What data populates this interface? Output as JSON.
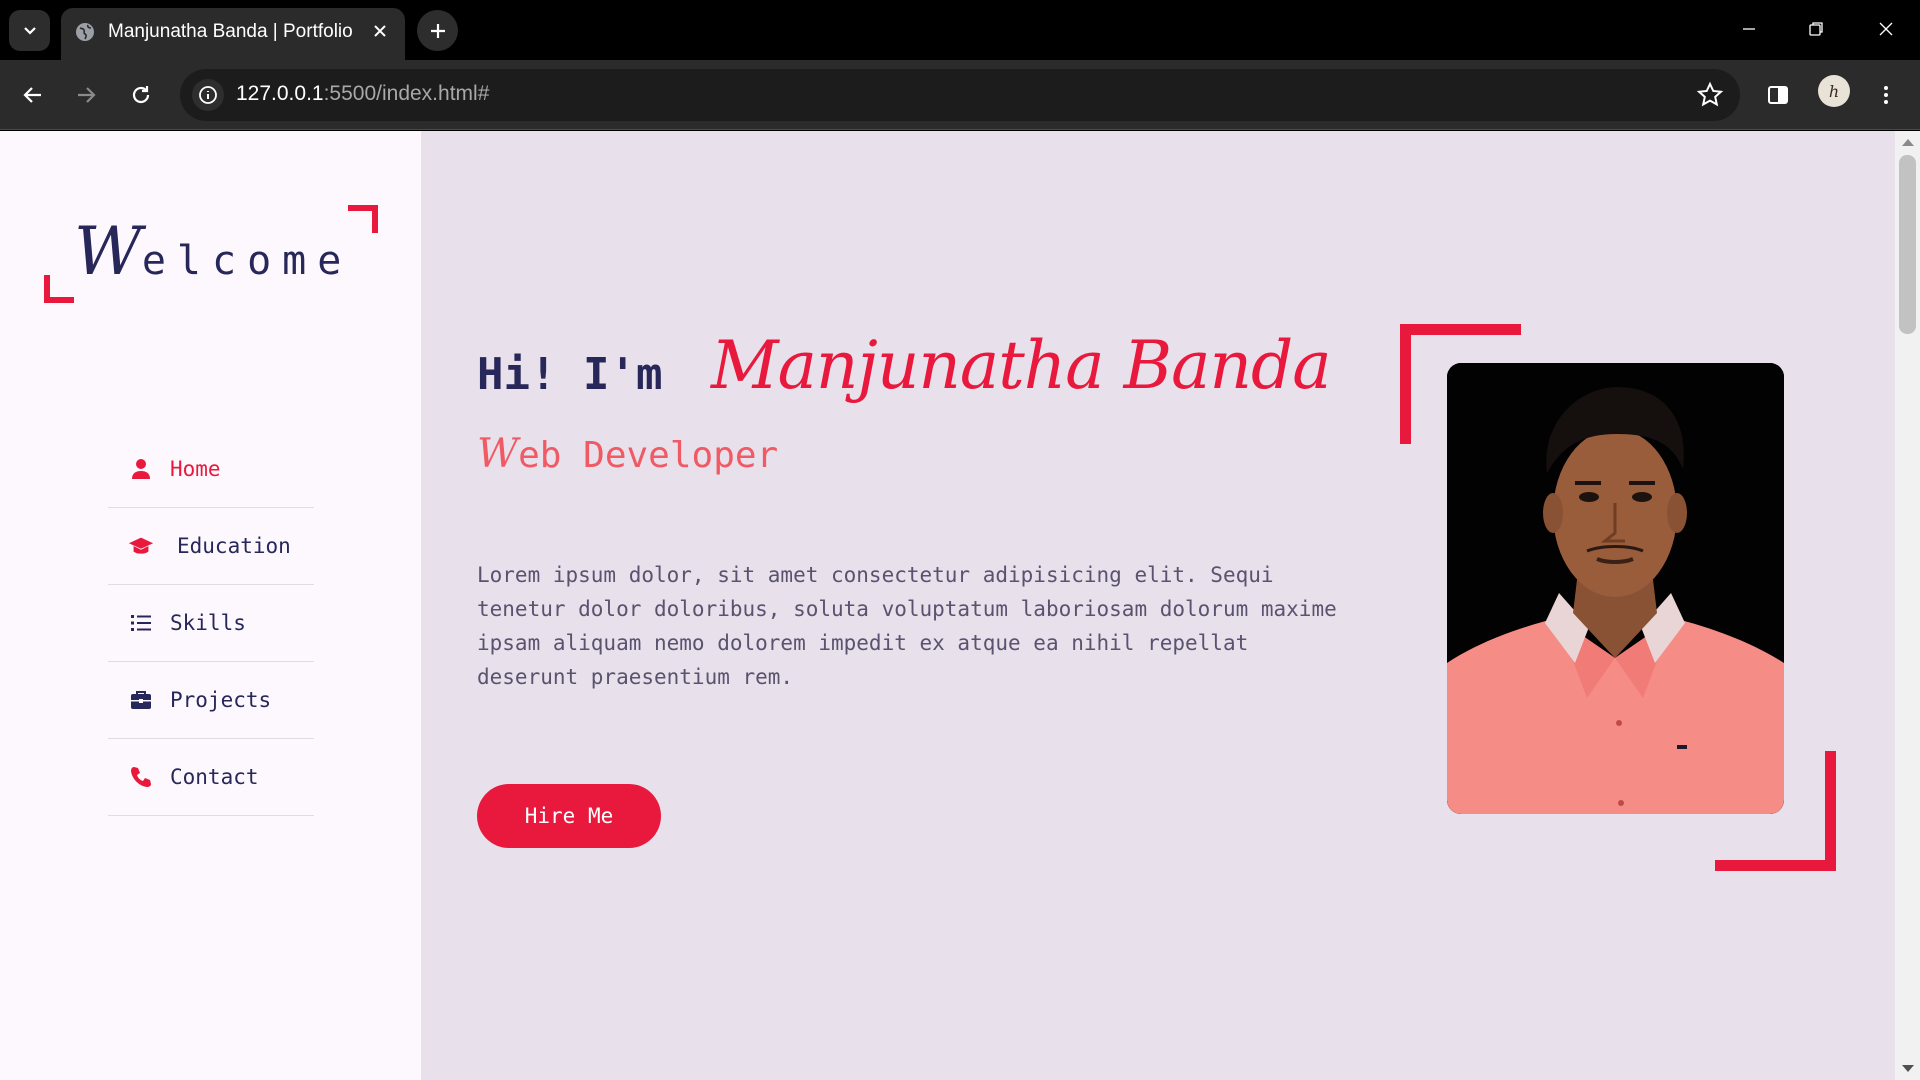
{
  "browser": {
    "tab_title": "Manjunatha Banda | Portfolio",
    "url_host": "127.0.0.1",
    "url_rest": ":5500/index.html#"
  },
  "sidebar": {
    "logo_cap": "W",
    "logo_rest": "elcome",
    "nav": [
      {
        "label": "Home",
        "icon": "user-icon",
        "active": true
      },
      {
        "label": "Education",
        "icon": "graduation-cap-icon",
        "active": false
      },
      {
        "label": "Skills",
        "icon": "list-icon",
        "active": false
      },
      {
        "label": "Projects",
        "icon": "briefcase-icon",
        "active": false
      },
      {
        "label": "Contact",
        "icon": "phone-icon",
        "active": false
      }
    ]
  },
  "hero": {
    "greeting": "Hi! I'm",
    "name": "Manjunatha Banda",
    "role_cap": "W",
    "role_rest": "eb Developer",
    "description": "Lorem ipsum dolor, sit amet consectetur adipisicing elit. Sequi tenetur dolor doloribus, soluta voluptatum laboriosam dolorum maxime ipsam aliquam nemo dolorem impedit ex atque ea nihil repellat deserunt praesentium rem.",
    "cta_label": "Hire Me"
  },
  "colors": {
    "accent": "#e8193d",
    "navy": "#27275a",
    "page_bg": "#e8e0ea",
    "sidebar_bg": "#fdf8fd"
  }
}
